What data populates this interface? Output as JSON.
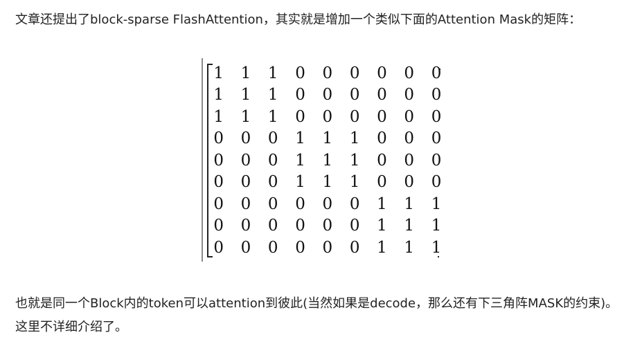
{
  "paragraphs": {
    "intro": "文章还提出了block-sparse FlashAttention，其实就是增加一个类似下面的Attention Mask的矩阵：",
    "explanation": "也就是同一个Block内的token可以attention到彼此(当然如果是decode，那么还有下三角阵MASK的约束)。这里不详细介绍了。"
  },
  "matrix": [
    [
      "1",
      "1",
      "1",
      "0",
      "0",
      "0",
      "0",
      "0",
      "0"
    ],
    [
      "1",
      "1",
      "1",
      "0",
      "0",
      "0",
      "0",
      "0",
      "0"
    ],
    [
      "1",
      "1",
      "1",
      "0",
      "0",
      "0",
      "0",
      "0",
      "0"
    ],
    [
      "0",
      "0",
      "0",
      "1",
      "1",
      "1",
      "0",
      "0",
      "0"
    ],
    [
      "0",
      "0",
      "0",
      "1",
      "1",
      "1",
      "0",
      "0",
      "0"
    ],
    [
      "0",
      "0",
      "0",
      "1",
      "1",
      "1",
      "0",
      "0",
      "0"
    ],
    [
      "0",
      "0",
      "0",
      "0",
      "0",
      "0",
      "1",
      "1",
      "1"
    ],
    [
      "0",
      "0",
      "0",
      "0",
      "0",
      "0",
      "1",
      "1",
      "1"
    ],
    [
      "0",
      "0",
      "0",
      "0",
      "0",
      "0",
      "1",
      "1",
      "1"
    ]
  ]
}
